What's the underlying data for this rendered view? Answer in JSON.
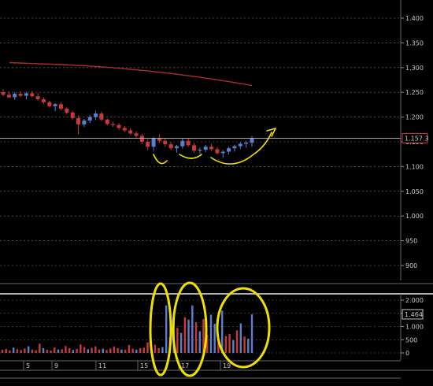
{
  "chart_data": [
    {
      "type": "candlestick",
      "panel": "price",
      "title": "",
      "y_axis_side": "right",
      "ylim": [
        870,
        1440
      ],
      "y_ticks": [
        "1.400",
        "1.350",
        "1.300",
        "1.250",
        "1.200",
        "1.150",
        "1.100",
        "1.050",
        "1.000",
        "950",
        "900"
      ],
      "y_tick_values": [
        1400,
        1350,
        1300,
        1250,
        1200,
        1150,
        1100,
        1050,
        1000,
        950,
        900
      ],
      "last_price_label": "1.157.3",
      "last_price_value": 1157.3,
      "grid": "horizontal dashed",
      "colors": {
        "up": "#5b7fd0",
        "down": "#c83a3a",
        "moving_average": "#b02a2a",
        "annotation": "#f0e000",
        "background": "#000000",
        "last_price_line": "#bfbfbf"
      },
      "moving_average": [
        1310,
        1308,
        1306,
        1303,
        1299,
        1294,
        1288,
        1281,
        1273,
        1264
      ],
      "candles": [
        [
          1250,
          1256,
          1243,
          1245
        ],
        [
          1245,
          1252,
          1238,
          1240
        ],
        [
          1240,
          1250,
          1235,
          1247
        ],
        [
          1247,
          1252,
          1240,
          1243
        ],
        [
          1243,
          1251,
          1236,
          1248
        ],
        [
          1248,
          1253,
          1240,
          1242
        ],
        [
          1242,
          1249,
          1233,
          1236
        ],
        [
          1236,
          1240,
          1226,
          1230
        ],
        [
          1230,
          1233,
          1219,
          1222
        ],
        [
          1222,
          1228,
          1212,
          1226
        ],
        [
          1226,
          1230,
          1214,
          1217
        ],
        [
          1217,
          1220,
          1205,
          1209
        ],
        [
          1209,
          1213,
          1195,
          1198
        ],
        [
          1198,
          1203,
          1165,
          1185
        ],
        [
          1185,
          1197,
          1180,
          1193
        ],
        [
          1193,
          1204,
          1188,
          1200
        ],
        [
          1200,
          1213,
          1194,
          1207
        ],
        [
          1207,
          1211,
          1192,
          1195
        ],
        [
          1195,
          1197,
          1183,
          1186
        ],
        [
          1186,
          1191,
          1180,
          1184
        ],
        [
          1184,
          1188,
          1174,
          1178
        ],
        [
          1178,
          1182,
          1170,
          1173
        ],
        [
          1173,
          1177,
          1164,
          1167
        ],
        [
          1167,
          1171,
          1158,
          1162
        ],
        [
          1162,
          1166,
          1145,
          1150
        ],
        [
          1150,
          1155,
          1133,
          1140
        ],
        [
          1140,
          1160,
          1132,
          1157
        ],
        [
          1157,
          1165,
          1148,
          1152
        ],
        [
          1152,
          1158,
          1140,
          1145
        ],
        [
          1145,
          1150,
          1133,
          1137
        ],
        [
          1137,
          1144,
          1128,
          1141
        ],
        [
          1141,
          1156,
          1136,
          1152
        ],
        [
          1152,
          1157,
          1140,
          1143
        ],
        [
          1143,
          1147,
          1128,
          1132
        ],
        [
          1132,
          1138,
          1126,
          1134
        ],
        [
          1134,
          1144,
          1129,
          1140
        ],
        [
          1140,
          1146,
          1132,
          1135
        ],
        [
          1135,
          1139,
          1124,
          1127
        ],
        [
          1127,
          1133,
          1118,
          1130
        ],
        [
          1130,
          1140,
          1124,
          1137
        ],
        [
          1137,
          1144,
          1130,
          1141
        ],
        [
          1141,
          1149,
          1136,
          1146
        ],
        [
          1146,
          1152,
          1138,
          1148
        ],
        [
          1148,
          1162,
          1140,
          1158
        ]
      ],
      "x_ticks": [
        "5",
        "9",
        "11",
        "15",
        "17",
        "19"
      ]
    },
    {
      "type": "bar",
      "panel": "volume",
      "y_axis_side": "right",
      "ylim": [
        -60,
        2100
      ],
      "y_ticks": [
        "2.000",
        "1.500",
        "1.000",
        "500",
        "0"
      ],
      "y_tick_values": [
        2000,
        1500,
        1000,
        500,
        0
      ],
      "last_value_label": "1.464",
      "last_value": 1464,
      "values": [
        120,
        150,
        90,
        200,
        140,
        110,
        170,
        250,
        130,
        100,
        350,
        180,
        120,
        90,
        200,
        130,
        140,
        260,
        180,
        110,
        150,
        320,
        220,
        140,
        190,
        250,
        130,
        160,
        110,
        170,
        240,
        180,
        130,
        120,
        300,
        160,
        120,
        180,
        200,
        400,
        260,
        310,
        180,
        220,
        1800,
        600,
        1500,
        950,
        760,
        1350,
        1260,
        1800,
        1160,
        820,
        1280,
        680,
        1450,
        1100,
        520,
        1600,
        640,
        720,
        480,
        860,
        1120,
        620,
        540,
        1464
      ],
      "bar_colors": [
        "down",
        "down",
        "down",
        "up",
        "down",
        "down",
        "down",
        "up",
        "down",
        "down",
        "down",
        "up",
        "down",
        "down",
        "down",
        "up",
        "down",
        "down",
        "down",
        "up",
        "down",
        "down",
        "down",
        "up",
        "down",
        "down",
        "down",
        "up",
        "down",
        "down",
        "down",
        "down",
        "up",
        "down",
        "down",
        "down",
        "up",
        "down",
        "down",
        "down",
        "up",
        "down",
        "down",
        "up",
        "up",
        "down",
        "up",
        "down",
        "up",
        "down",
        "up",
        "up",
        "down",
        "up",
        "down",
        "down",
        "up",
        "up",
        "down",
        "up",
        "down",
        "down",
        "up",
        "down",
        "up",
        "down",
        "up",
        "up"
      ],
      "annotation": "three yellow ellipses circling volume spikes"
    }
  ]
}
